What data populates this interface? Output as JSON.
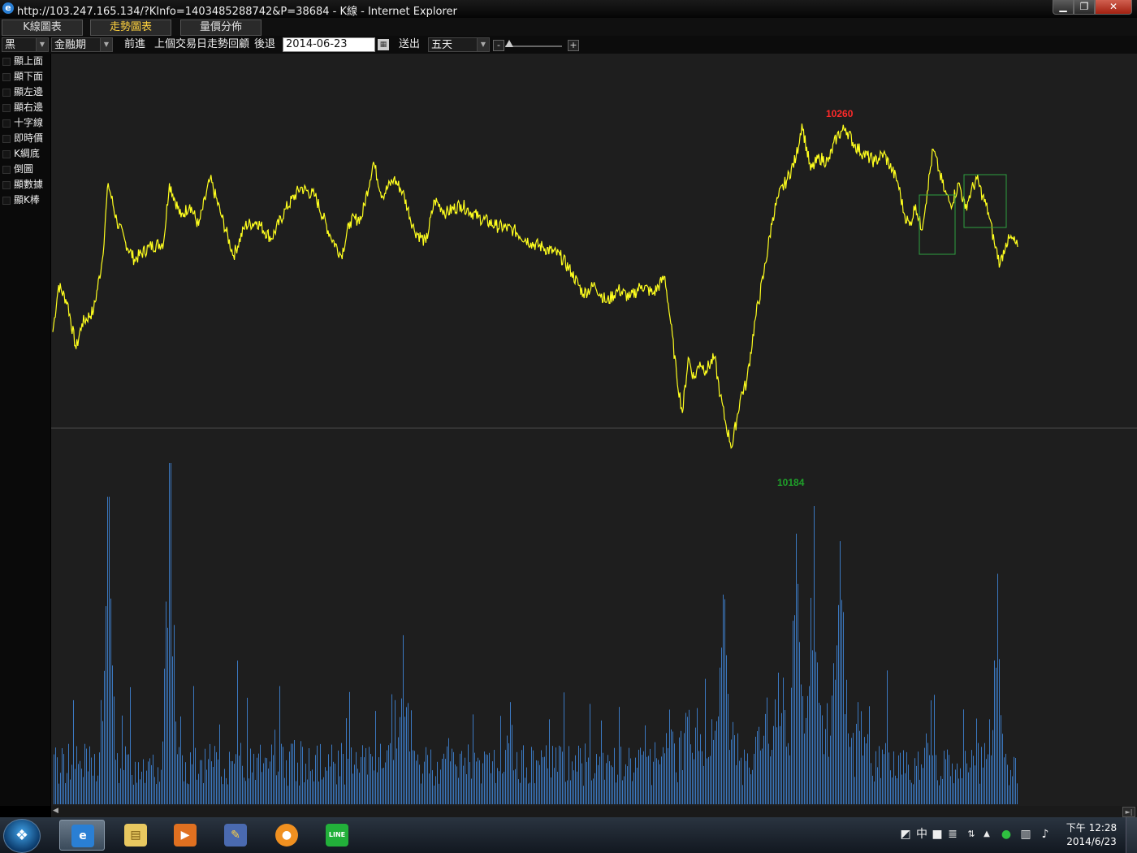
{
  "window": {
    "title": "http://103.247.165.134/?KInfo=1403485288742&P=38684 - K線 - Internet Explorer",
    "ie_icon": "e",
    "buttons": {
      "minimize": "▁",
      "maximize": "❐",
      "close": "✕"
    }
  },
  "tabs": [
    {
      "label": "K線圖表",
      "active": false
    },
    {
      "label": "走勢圖表",
      "active": true
    },
    {
      "label": "量價分佈",
      "active": false
    }
  ],
  "toolbar": {
    "color_select": "黑",
    "product_select": "金融期",
    "forward": "前進",
    "prev_day_review": "上個交易日走勢回顧",
    "back": "後退",
    "date": "2014-06-23",
    "calendar_icon": "▦",
    "submit": "送出",
    "range_select": "五天",
    "zoom_minus": "-",
    "zoom_plus": "+",
    "zoom_level": 0.02
  },
  "sidebar": {
    "items": [
      "顯上面",
      "顯下面",
      "顯左邊",
      "顯右邊",
      "十字線",
      "即時價",
      "K綢底",
      "倒圖",
      "顯數據",
      "顯K棒"
    ]
  },
  "chart": {
    "high_label": "10260",
    "low_label": "10184",
    "colors": {
      "price_line": "#ffff1e",
      "volume": "#3b78c0",
      "high": "#ff2a2a",
      "low": "#1fa02a",
      "box": "#2fa040",
      "bg": "#1e1e1e",
      "separator": "#4a4a4a"
    }
  },
  "chart_data": {
    "type": "line",
    "title": "",
    "xlabel": "",
    "ylabel": "",
    "ylim": [
      10180,
      10265
    ],
    "price_series": [
      {
        "x": 0,
        "y": 10211
      },
      {
        "x": 2,
        "y": 10222
      },
      {
        "x": 5,
        "y": 10218
      },
      {
        "x": 8,
        "y": 10207
      },
      {
        "x": 10,
        "y": 10213
      },
      {
        "x": 14,
        "y": 10216
      },
      {
        "x": 17,
        "y": 10228
      },
      {
        "x": 19,
        "y": 10246
      },
      {
        "x": 22,
        "y": 10237
      },
      {
        "x": 25,
        "y": 10232
      },
      {
        "x": 28,
        "y": 10228
      },
      {
        "x": 33,
        "y": 10231
      },
      {
        "x": 38,
        "y": 10232
      },
      {
        "x": 40,
        "y": 10246
      },
      {
        "x": 44,
        "y": 10238
      },
      {
        "x": 47,
        "y": 10241
      },
      {
        "x": 50,
        "y": 10236
      },
      {
        "x": 54,
        "y": 10247
      },
      {
        "x": 58,
        "y": 10238
      },
      {
        "x": 62,
        "y": 10229
      },
      {
        "x": 66,
        "y": 10236
      },
      {
        "x": 70,
        "y": 10237
      },
      {
        "x": 75,
        "y": 10233
      },
      {
        "x": 80,
        "y": 10240
      },
      {
        "x": 85,
        "y": 10245
      },
      {
        "x": 90,
        "y": 10243
      },
      {
        "x": 95,
        "y": 10234
      },
      {
        "x": 99,
        "y": 10229
      },
      {
        "x": 102,
        "y": 10237
      },
      {
        "x": 106,
        "y": 10238
      },
      {
        "x": 110,
        "y": 10251
      },
      {
        "x": 113,
        "y": 10243
      },
      {
        "x": 117,
        "y": 10247
      },
      {
        "x": 120,
        "y": 10244
      },
      {
        "x": 124,
        "y": 10235
      },
      {
        "x": 128,
        "y": 10232
      },
      {
        "x": 131,
        "y": 10242
      },
      {
        "x": 135,
        "y": 10239
      },
      {
        "x": 140,
        "y": 10241
      },
      {
        "x": 146,
        "y": 10238
      },
      {
        "x": 152,
        "y": 10236
      },
      {
        "x": 158,
        "y": 10235
      },
      {
        "x": 164,
        "y": 10232
      },
      {
        "x": 168,
        "y": 10231
      },
      {
        "x": 174,
        "y": 10229
      },
      {
        "x": 178,
        "y": 10225
      },
      {
        "x": 182,
        "y": 10220
      },
      {
        "x": 186,
        "y": 10222
      },
      {
        "x": 190,
        "y": 10218
      },
      {
        "x": 194,
        "y": 10221
      },
      {
        "x": 198,
        "y": 10219
      },
      {
        "x": 202,
        "y": 10222
      },
      {
        "x": 206,
        "y": 10220
      },
      {
        "x": 210,
        "y": 10224
      },
      {
        "x": 212,
        "y": 10213
      },
      {
        "x": 214,
        "y": 10201
      },
      {
        "x": 216,
        "y": 10192
      },
      {
        "x": 218,
        "y": 10205
      },
      {
        "x": 220,
        "y": 10200
      },
      {
        "x": 222,
        "y": 10204
      },
      {
        "x": 224,
        "y": 10202
      },
      {
        "x": 227,
        "y": 10205
      },
      {
        "x": 229,
        "y": 10196
      },
      {
        "x": 231,
        "y": 10189
      },
      {
        "x": 233,
        "y": 10184
      },
      {
        "x": 236,
        "y": 10196
      },
      {
        "x": 238,
        "y": 10199
      },
      {
        "x": 241,
        "y": 10214
      },
      {
        "x": 244,
        "y": 10225
      },
      {
        "x": 247,
        "y": 10238
      },
      {
        "x": 249,
        "y": 10243
      },
      {
        "x": 252,
        "y": 10247
      },
      {
        "x": 255,
        "y": 10252
      },
      {
        "x": 257,
        "y": 10260
      },
      {
        "x": 260,
        "y": 10249
      },
      {
        "x": 263,
        "y": 10252
      },
      {
        "x": 266,
        "y": 10251
      },
      {
        "x": 269,
        "y": 10257
      },
      {
        "x": 272,
        "y": 10259
      },
      {
        "x": 275,
        "y": 10255
      },
      {
        "x": 278,
        "y": 10253
      },
      {
        "x": 282,
        "y": 10251
      },
      {
        "x": 285,
        "y": 10253
      },
      {
        "x": 288,
        "y": 10249
      },
      {
        "x": 290,
        "y": 10246
      },
      {
        "x": 292,
        "y": 10239
      },
      {
        "x": 294,
        "y": 10236
      },
      {
        "x": 296,
        "y": 10241
      },
      {
        "x": 298,
        "y": 10235
      },
      {
        "x": 300,
        "y": 10244
      },
      {
        "x": 302,
        "y": 10254
      },
      {
        "x": 304,
        "y": 10249
      },
      {
        "x": 306,
        "y": 10244
      },
      {
        "x": 308,
        "y": 10241
      },
      {
        "x": 311,
        "y": 10246
      },
      {
        "x": 313,
        "y": 10240
      },
      {
        "x": 315,
        "y": 10244
      },
      {
        "x": 317,
        "y": 10247
      },
      {
        "x": 319,
        "y": 10243
      },
      {
        "x": 321,
        "y": 10239
      },
      {
        "x": 323,
        "y": 10232
      },
      {
        "x": 325,
        "y": 10227
      },
      {
        "x": 327,
        "y": 10232
      },
      {
        "x": 329,
        "y": 10233
      },
      {
        "x": 331,
        "y": 10231
      }
    ],
    "volume_series": {
      "name": "",
      "peaks": [
        {
          "x": 19,
          "v": 100
        },
        {
          "x": 40,
          "v": 111
        },
        {
          "x": 120,
          "v": 55
        },
        {
          "x": 255,
          "v": 73
        },
        {
          "x": 261,
          "v": 80
        },
        {
          "x": 270,
          "v": 84
        },
        {
          "x": 324,
          "v": 75
        },
        {
          "x": 230,
          "v": 60
        }
      ]
    }
  },
  "taskbar": {
    "apps": [
      {
        "name": "internet-explorer",
        "icon": "e",
        "active": true
      },
      {
        "name": "file-explorer",
        "icon": "▤",
        "active": false
      },
      {
        "name": "media-player",
        "icon": "▶",
        "active": false
      },
      {
        "name": "paint-app",
        "icon": "✎",
        "active": false
      },
      {
        "name": "browser-app",
        "icon": "●",
        "active": false
      },
      {
        "name": "line-app",
        "icon": "LINE",
        "active": false
      }
    ],
    "tray": {
      "ime": "中",
      "time": "下午 12:28",
      "date": "2014/6/23"
    }
  }
}
